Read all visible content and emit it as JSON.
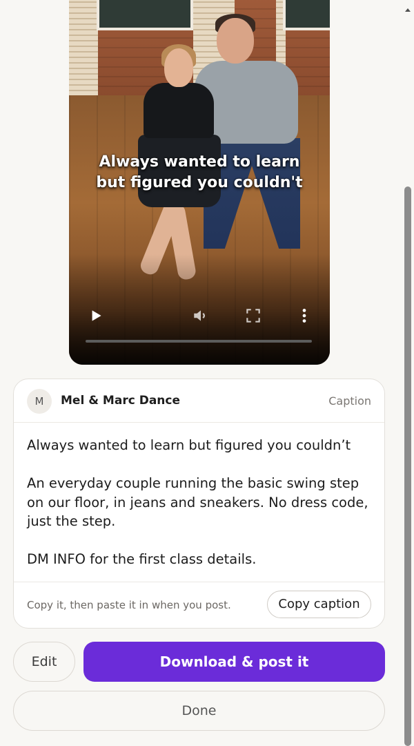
{
  "video": {
    "overlay_line1": "Always wanted to learn",
    "overlay_line2": "but figured you couldn't",
    "controls": {
      "play_icon": "play-icon",
      "mute_icon": "volume-icon",
      "fullscreen_icon": "fullscreen-icon",
      "more_icon": "more-vertical-icon"
    },
    "progress_fraction": 0
  },
  "caption_card": {
    "avatar_initial": "M",
    "account_name": "Mel & Marc Dance",
    "tag": "Caption",
    "paragraphs": [
      "Always wanted to learn but figured you couldn’t",
      "An everyday couple running the basic swing step on our floor, in jeans and sneakers. No dress code, just the step.",
      "DM INFO for the first class details."
    ],
    "hint": "Copy it, then paste it in when you post.",
    "copy_button": "Copy caption"
  },
  "actions": {
    "edit": "Edit",
    "primary": "Download & post it",
    "done": "Done"
  },
  "colors": {
    "accent": "#6b2cd9",
    "background": "#f8f7f4"
  }
}
